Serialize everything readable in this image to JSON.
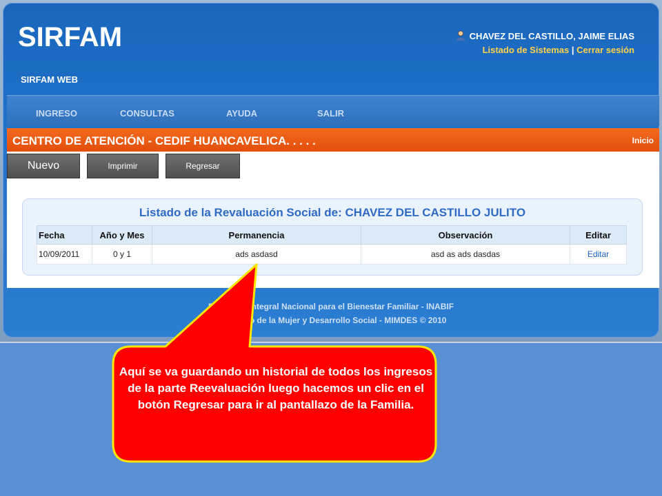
{
  "app": {
    "logo": "SIRFAM",
    "subtitle": "SIRFAM WEB",
    "user_name": "CHAVEZ DEL CASTILLO, JAIME ELIAS",
    "link_systems": "Listado de Sistemas",
    "link_separator": "|",
    "link_logout": "Cerrar sesión"
  },
  "nav": {
    "items": [
      "INGRESO",
      "CONSULTAS",
      "AYUDA",
      "SALIR"
    ]
  },
  "center": {
    "title": "CENTRO DE ATENCIÓN - CEDIF HUANCAVELICA. . . . .",
    "home_link": "Inicio"
  },
  "toolbar": {
    "new_label": "Nuevo",
    "print_label": "Imprimir",
    "back_label": "Regresar"
  },
  "listing": {
    "title": "Listado de la Revaluación Social de: CHAVEZ DEL CASTILLO JULITO",
    "columns": [
      "Fecha",
      "Año y Mes",
      "Permanencia",
      "Observación",
      "Editar"
    ],
    "rows": [
      {
        "fecha": "10/09/2011",
        "anio_mes": "0 y 1",
        "permanencia": "ads asdasd",
        "observacion": "asd as ads dasdas",
        "editar": "Editar"
      }
    ]
  },
  "footer": {
    "line1": "Programa Integral Nacional para el Bienestar Familiar - INABIF",
    "line2": "Ministerio de la Mujer y Desarrollo Social - MIMDES © 2010"
  },
  "callout": {
    "text": "Aquí se va guardando un historial de todos los ingresos de la parte Reevaluación  luego hacemos un clic en el botón Regresar para ir al pantallazo  de la Familia."
  },
  "colors": {
    "header_blue": "#1f72c9",
    "orange_bar": "#e8560f",
    "callout_red": "#ff0000",
    "callout_border": "#ffe800",
    "link_yellow": "#ffd24a"
  }
}
